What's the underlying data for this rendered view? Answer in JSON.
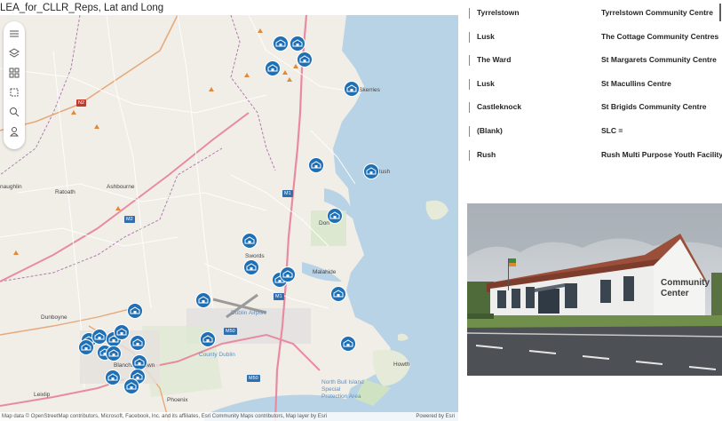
{
  "map": {
    "title": "LEA_for_CLLR_Reps, Lat and Long",
    "labels": {
      "naughlin": "naughlin",
      "ratoath": "Ratoath",
      "ashbourne": "Ashbourne",
      "swords": "Swords",
      "malahide": "Malahide",
      "donabate": "Don",
      "dunboyne": "Dunboyne",
      "dublin_airport": "Dublin Airport",
      "county_dublin": "County Dublin",
      "howth": "Howth",
      "north_bull": "North Bull Island Special Protection Area",
      "phoenix": "Phoenix",
      "leixlip": "Leixlip",
      "skerries": "Skerries",
      "rush": "Rush",
      "blanchardstown": "Blanchardstown"
    },
    "road_shields": {
      "n2": "N2",
      "m1a": "M1",
      "m1b": "M1",
      "m2": "M2",
      "m50a": "M50",
      "m50b": "M50"
    },
    "toolbar_icons": [
      "menu-icon",
      "layers-icon",
      "grid-icon",
      "select-icon",
      "search-icon",
      "person-icon"
    ],
    "attribution_left": "Map data © OpenStreetMap contributors, Microsoft, Facebook, Inc. and its affiliates, Esri Community Maps contributors, Map layer by Esri",
    "attribution_right": "Powered by Esri",
    "marker_color": "#1f6fb5"
  },
  "table": {
    "rows": [
      {
        "lea": "Tyrrelstown",
        "venue": "Tyrrelstown Community Centre"
      },
      {
        "lea": "Lusk",
        "venue": "The Cottage Community Centres"
      },
      {
        "lea": "The Ward",
        "venue": "St Margarets Community Centre"
      },
      {
        "lea": "Lusk",
        "venue": "St Macullins Centre"
      },
      {
        "lea": "Castleknock",
        "venue": "St Brigids Community Centre"
      },
      {
        "lea": "(Blank)",
        "venue": "SLC ="
      },
      {
        "lea": "Rush",
        "venue": "Rush Multi Purpose Youth Facility"
      }
    ]
  },
  "photo": {
    "sign": [
      "Community",
      "Center"
    ]
  }
}
